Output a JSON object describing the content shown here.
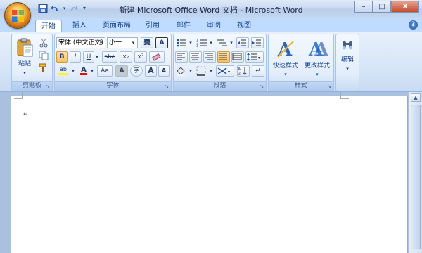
{
  "window": {
    "title": "新建 Microsoft Office Word 文档 - Microsoft Word",
    "min_label": "–",
    "max_label": "□",
    "close_label": "X"
  },
  "qat": {
    "save": "💾",
    "undo": "↶",
    "undo_dd": "▾",
    "redo": "↷",
    "customize": "▾"
  },
  "tabs": [
    "开始",
    "插入",
    "页面布局",
    "引用",
    "邮件",
    "审阅",
    "视图"
  ],
  "active_tab": 0,
  "help": "?",
  "clipboard": {
    "group_label": "剪贴板",
    "paste_label": "粘贴",
    "paste_arrow": "▾"
  },
  "font": {
    "group_label": "字体",
    "font_name": "宋体 (中文正文)",
    "font_size": "小一",
    "phonetic_label": "變",
    "border_label": "A",
    "bold": "B",
    "italic": "I",
    "underline": "U",
    "underline_dd": "▾",
    "strike": "abe",
    "subscript": "x₂",
    "superscript": "x²",
    "highlight_label": "ab",
    "font_color_label": "A",
    "change_case": "Aa",
    "shade_label": "A",
    "enclose_label": "字",
    "grow_font": "A",
    "shrink_font": "A"
  },
  "paragraph": {
    "group_label": "段落",
    "dd": "▾",
    "sort_label": "A↓",
    "show_marks": "↵"
  },
  "styles": {
    "group_label": "样式",
    "quick_styles": "快速样式",
    "change_styles": "更改样式",
    "dd": "▾"
  },
  "editing": {
    "label": "编辑",
    "dd": "▾"
  },
  "document": {
    "paragraph_mark": "↵"
  },
  "colors": {
    "highlight": "#ffff00",
    "font_color": "#ff0000",
    "accent": "#15428b"
  }
}
